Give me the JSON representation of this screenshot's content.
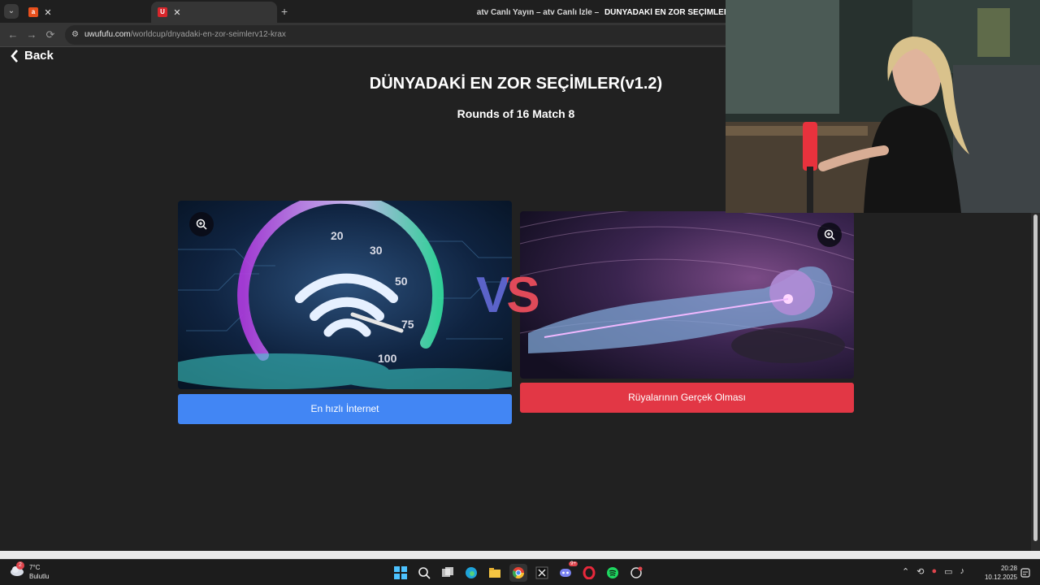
{
  "browser": {
    "tabs": [
      {
        "label": "atv Canlı Yayın – atv Canlı İzle –",
        "active": false,
        "favicon_color": "#e8501d"
      },
      {
        "label": "DÜNYADAKİ EN ZOR SEÇİMLER",
        "active": true,
        "favicon_color": "#d7262b",
        "favicon_letter": "U"
      }
    ],
    "url_host": "uwufufu.com",
    "url_path": "/worldcup/dnyadaki-en-zor-seimlerv12-krax"
  },
  "page": {
    "back_label": "Back",
    "title": "DÜNYADAKİ EN ZOR SEÇİMLER(v1.2)",
    "round_info": "Rounds of 16 Match 8",
    "vs_label": "VS",
    "left_choice": {
      "label": "En hızlı İnternet",
      "button_color": "#4286f4",
      "speed_labels": [
        "20",
        "30",
        "50",
        "75",
        "100"
      ]
    },
    "right_choice": {
      "label": "Rüyalarının Gerçek Olması",
      "button_color": "#e23745"
    }
  },
  "taskbar": {
    "weather_temp": "7°C",
    "weather_desc": "Bulutlu",
    "weather_badge": "2",
    "discord_badge": "9+",
    "time": "20:28",
    "date": "10.12.2025"
  },
  "colors": {
    "page_bg": "#212121",
    "vs_left": "#5b63c9",
    "vs_right": "#e04a59"
  }
}
